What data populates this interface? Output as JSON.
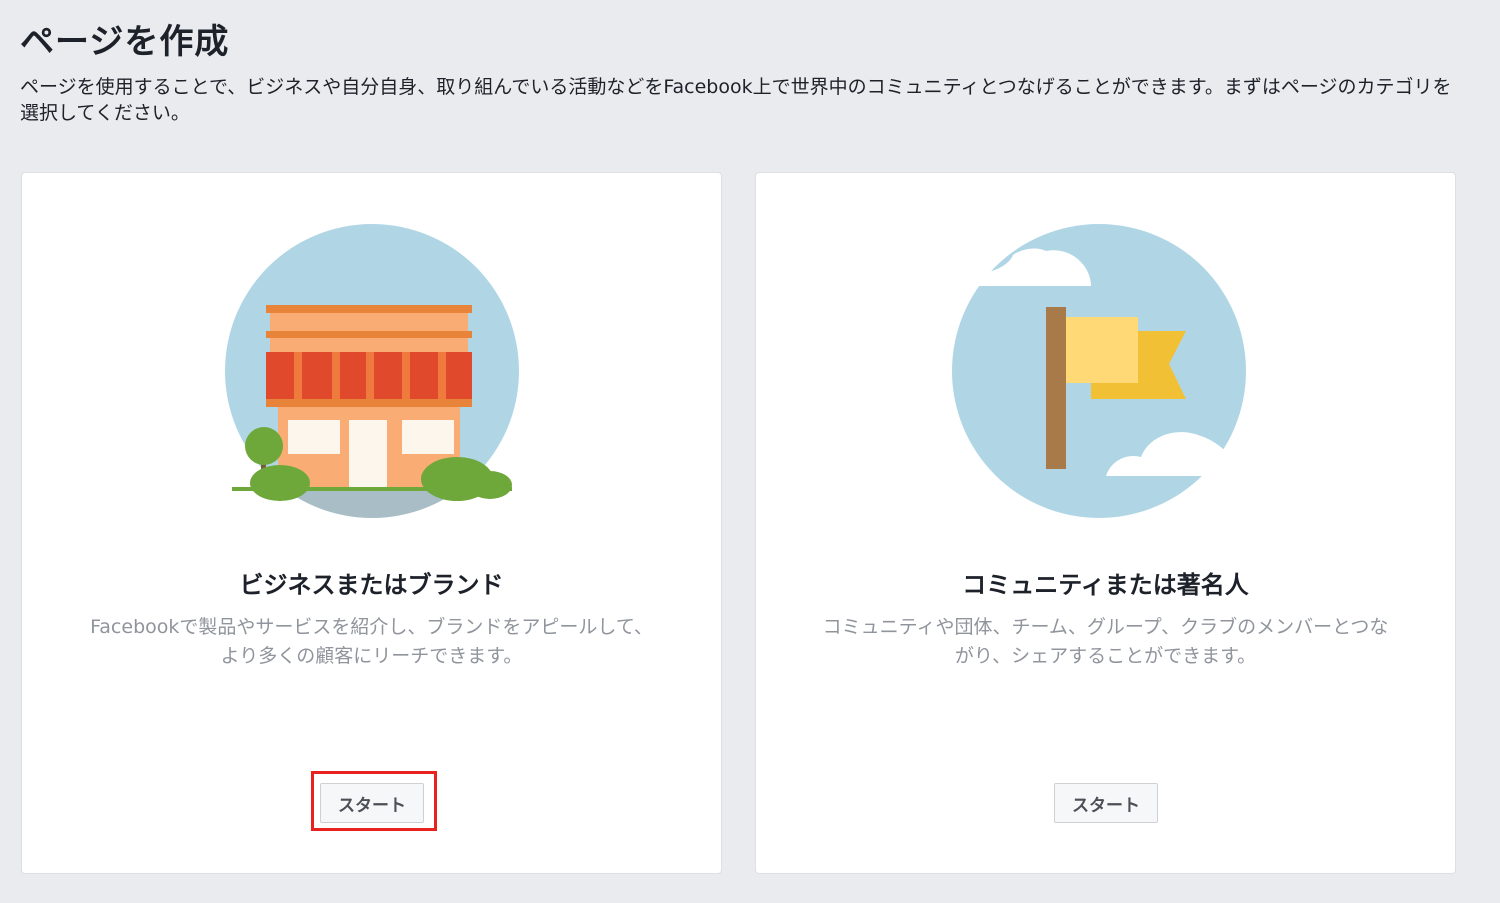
{
  "page": {
    "title": "ページを作成",
    "description": "ページを使用することで、ビジネスや自分自身、取り組んでいる活動などをFacebook上で世界中のコミュニティとつなげることができます。まずはページのカテゴリを選択してください。"
  },
  "cards": [
    {
      "title": "ビジネスまたはブランド",
      "description": "Facebookで製品やサービスを紹介し、ブランドをアピールして、より多くの顧客にリーチできます。",
      "button_label": "スタート",
      "icon": "storefront-illustration",
      "highlighted": true
    },
    {
      "title": "コミュニティまたは著名人",
      "description": "コミュニティや団体、チーム、グループ、クラブのメンバーとつながり、シェアすることができます。",
      "button_label": "スタート",
      "icon": "flag-illustration",
      "highlighted": false
    }
  ],
  "colors": {
    "background": "#e9ebee",
    "card": "#ffffff",
    "illustration_circle": "#b0d6e6",
    "highlight": "#e8231f"
  }
}
